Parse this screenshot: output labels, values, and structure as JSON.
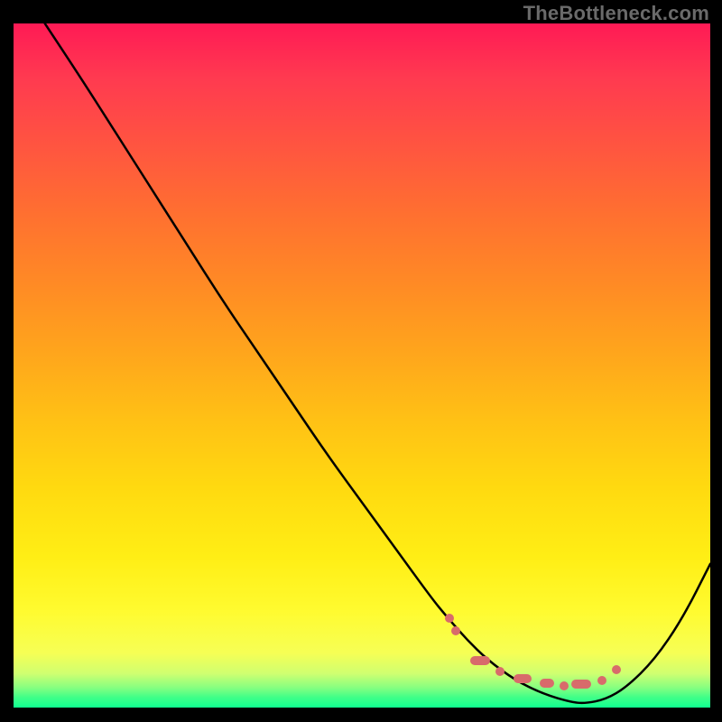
{
  "watermark": "TheBottleneck.com",
  "chart_data": {
    "type": "line",
    "title": "",
    "xlabel": "",
    "ylabel": "",
    "xlim": [
      0,
      100
    ],
    "ylim": [
      0,
      100
    ],
    "series": [
      {
        "name": "curve",
        "color": "#000000",
        "x": [
          4.5,
          10,
          15,
          20,
          25,
          30,
          35,
          40,
          45,
          50,
          55,
          60,
          62,
          65,
          68,
          72,
          76,
          80,
          82,
          85,
          88,
          92,
          96,
          100
        ],
        "y": [
          100,
          91.5,
          83.5,
          75.5,
          67.5,
          59.5,
          52,
          44.5,
          37,
          30,
          23,
          16,
          13.5,
          10,
          7,
          4,
          2,
          0.8,
          0.6,
          1.2,
          3,
          7,
          13,
          21
        ]
      }
    ],
    "markers": [
      {
        "shape": "dot",
        "x": 62.5,
        "y": 13.0
      },
      {
        "shape": "dot",
        "x": 63.5,
        "y": 11.2
      },
      {
        "shape": "pill",
        "x": 67.0,
        "y": 6.8,
        "w": 22
      },
      {
        "shape": "dot",
        "x": 69.8,
        "y": 5.3
      },
      {
        "shape": "pill",
        "x": 73.0,
        "y": 4.2,
        "w": 20
      },
      {
        "shape": "pill",
        "x": 76.5,
        "y": 3.6,
        "w": 16
      },
      {
        "shape": "dot",
        "x": 79.0,
        "y": 3.2
      },
      {
        "shape": "pill",
        "x": 81.5,
        "y": 3.4,
        "w": 22
      },
      {
        "shape": "dot",
        "x": 84.5,
        "y": 4.0
      },
      {
        "shape": "dot",
        "x": 86.5,
        "y": 5.6
      }
    ],
    "background_gradient": {
      "top": "#ff1a55",
      "bottom": "#10ff90"
    }
  }
}
